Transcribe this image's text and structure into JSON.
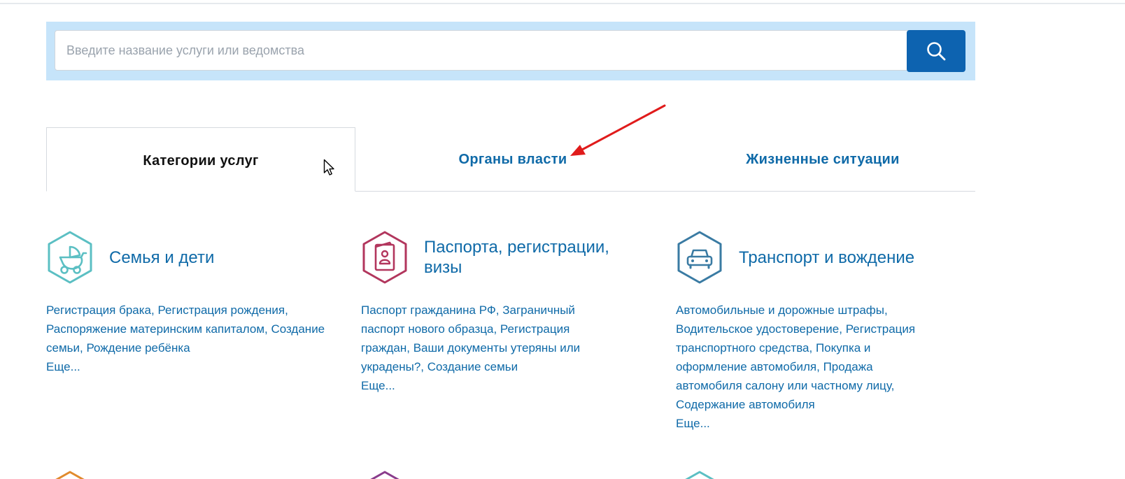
{
  "search": {
    "placeholder": "Введите название услуги или ведомства",
    "value": ""
  },
  "tabs": [
    {
      "label": "Категории услуг",
      "active": true
    },
    {
      "label": "Органы власти",
      "active": false
    },
    {
      "label": "Жизненные ситуации",
      "active": false
    }
  ],
  "categories": [
    {
      "title": "Семья и дети",
      "icon": "baby-stroller-icon",
      "color": "#5bbfc3",
      "links_text": "Регистрация брака, Регистрация рождения, Распоряжение материнским капиталом, Создание семьи, Рождение ребёнка",
      "more": "Еще..."
    },
    {
      "title": "Паспорта, регистрации, визы",
      "icon": "passport-icon",
      "color": "#b2365d",
      "links_text": "Паспорт гражданина РФ, Заграничный паспорт нового образца, Регистрация граждан, Ваши документы утеряны или украдены?, Создание семьи",
      "more": "Еще..."
    },
    {
      "title": "Транспорт и вождение",
      "icon": "car-icon",
      "color": "#3a7ba3",
      "links_text": "Автомобильные и дорожные штрафы, Водительское удостоверение, Регистрация транспортного средства, Покупка и оформление автомобиля, Продажа автомобиля салону или частному лицу, Содержание автомобиля",
      "more": "Еще..."
    }
  ],
  "colors": {
    "accent": "#0d63b0",
    "link": "#0f6aa8",
    "search_band": "#c6e4fa",
    "annotation_arrow": "#e01b1b"
  }
}
